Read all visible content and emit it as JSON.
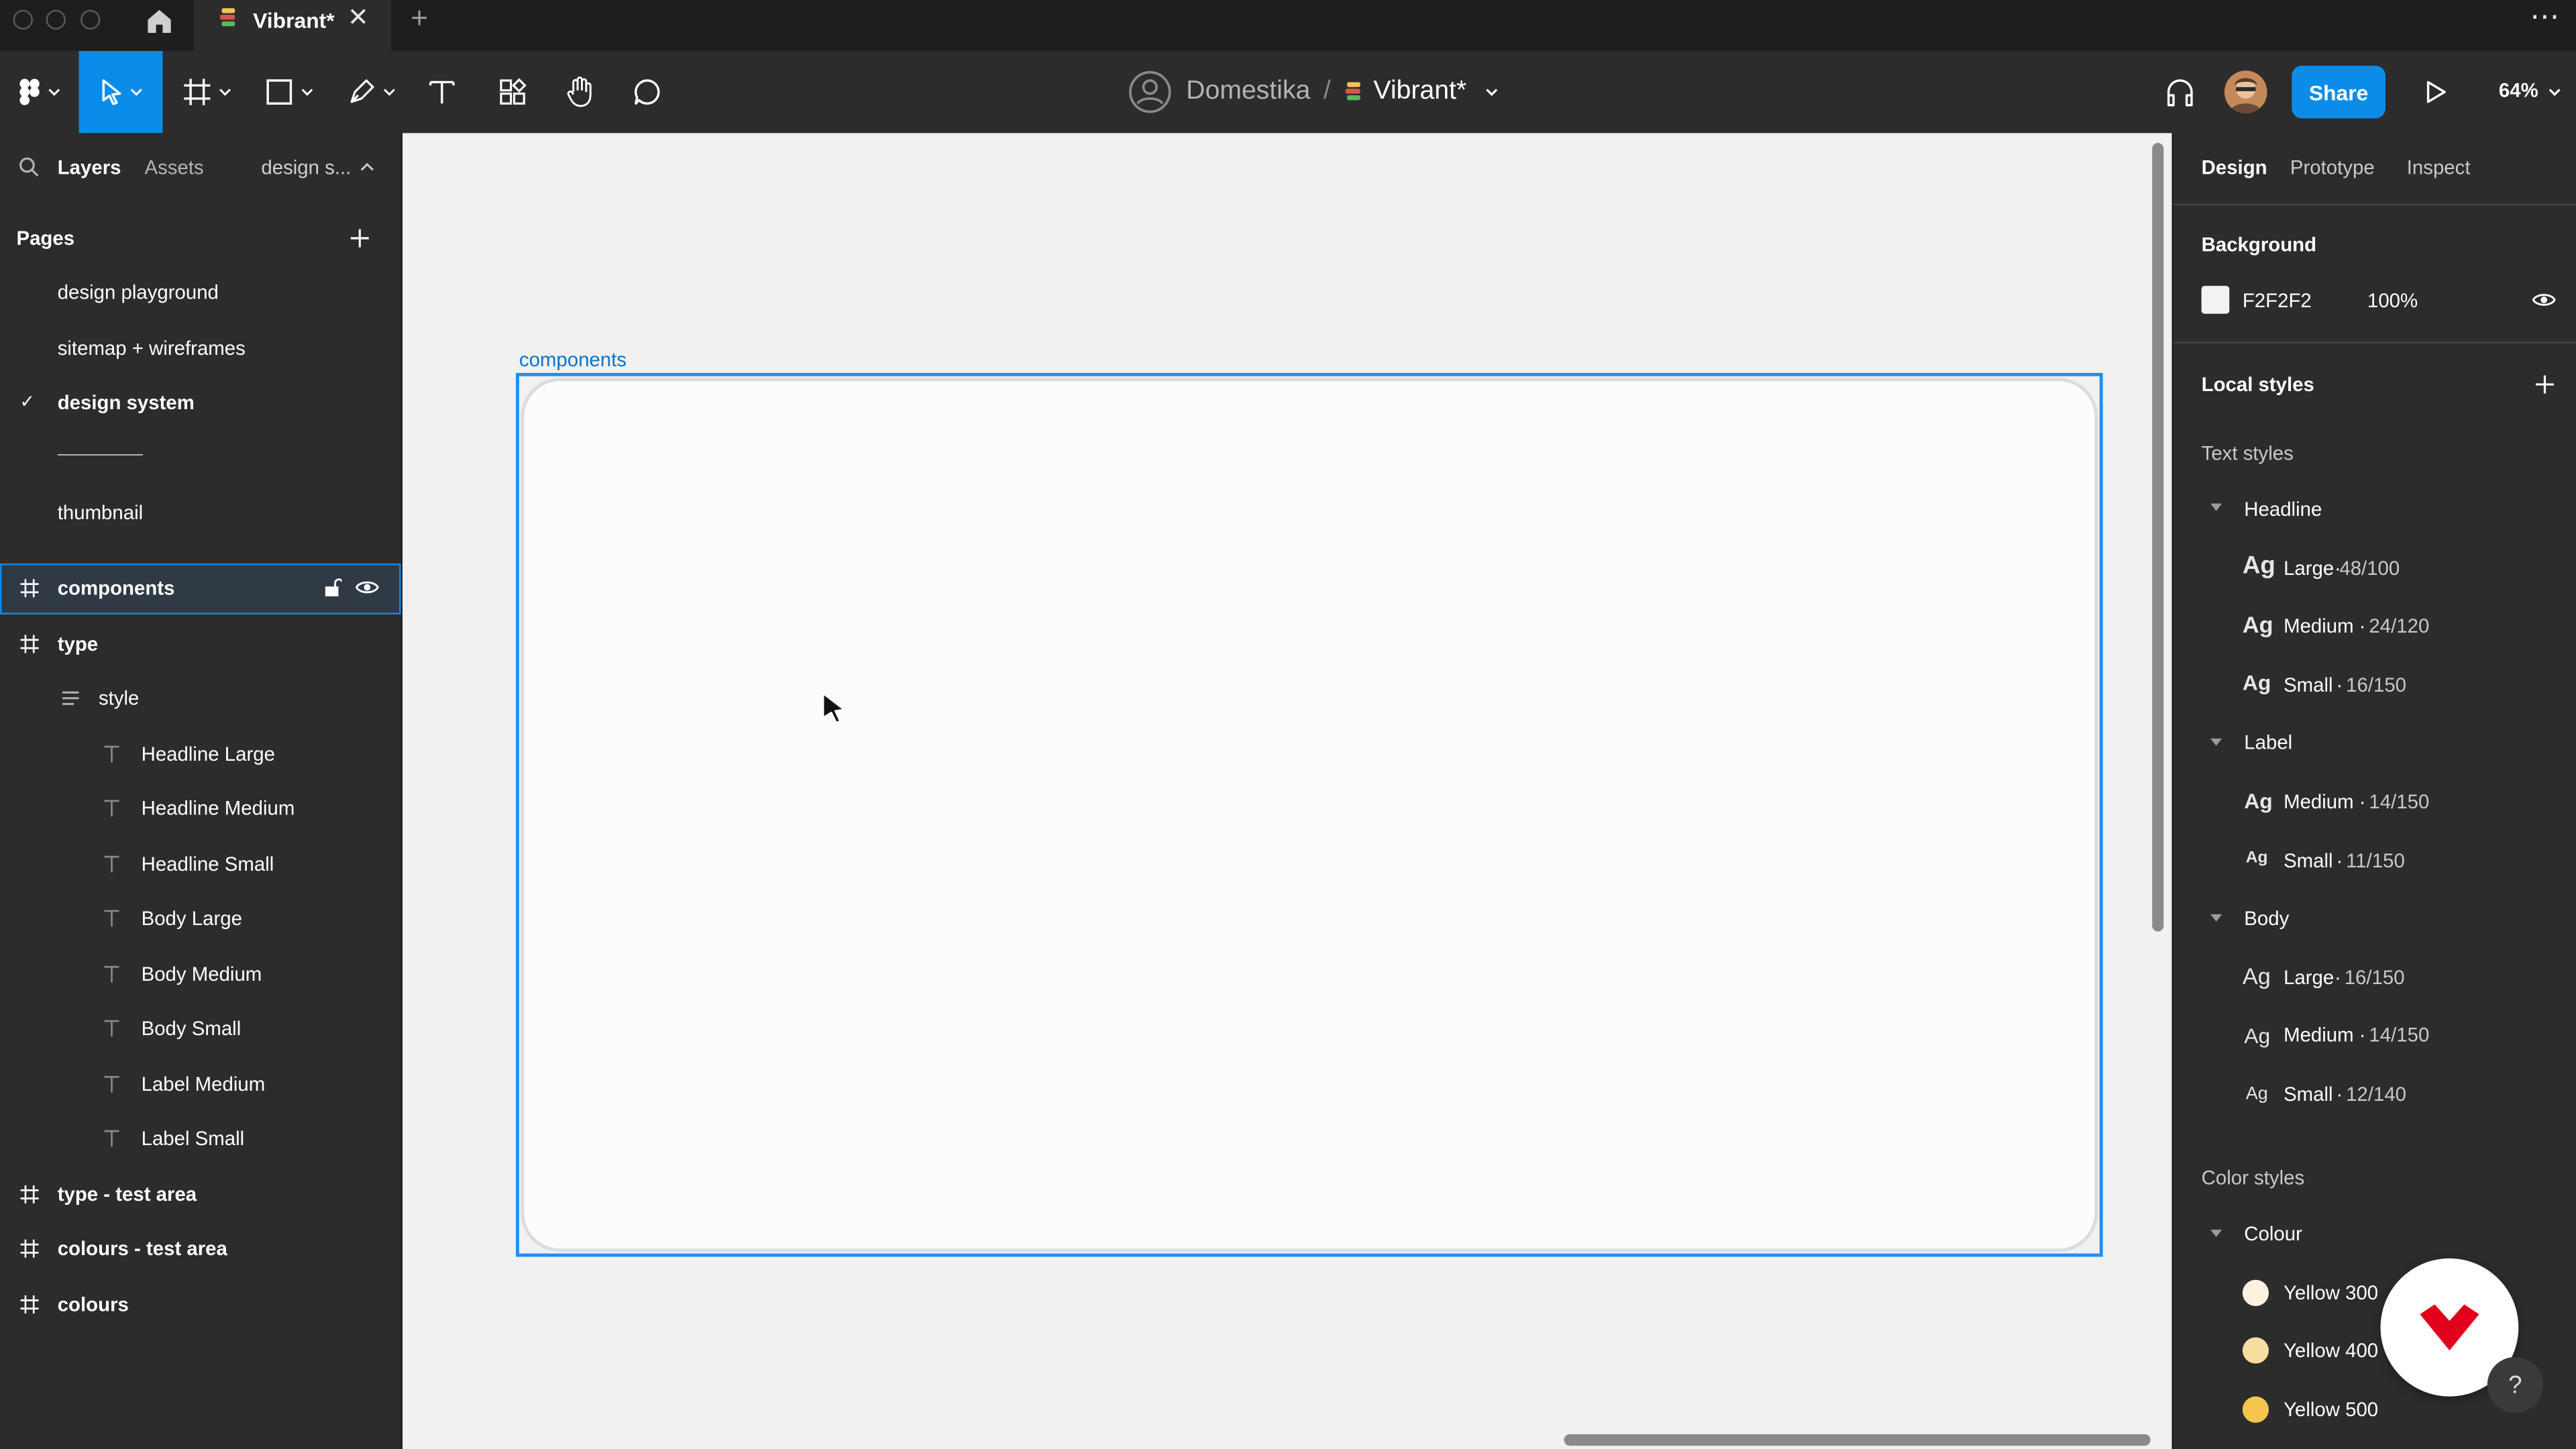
{
  "window": {
    "tab_title": "Vibrant*",
    "new_tab": "+",
    "more": "⋯"
  },
  "toolbar": {
    "team": "Domestika",
    "separator": "/",
    "file_name": "Vibrant*",
    "share_label": "Share",
    "zoom": "64%"
  },
  "left_panel": {
    "tabs": [
      "Layers",
      "Assets"
    ],
    "page_selector": "design s...",
    "pages_title": "Pages",
    "pages": [
      {
        "label": "design playground",
        "selected": false
      },
      {
        "label": "sitemap + wireframes",
        "selected": false
      },
      {
        "label": "design system",
        "selected": true
      },
      {
        "label": "—————",
        "selected": false
      },
      {
        "label": "thumbnail",
        "selected": false
      }
    ],
    "check_mark": "✓",
    "layers": [
      {
        "label": "components",
        "type": "frame",
        "selected": true
      },
      {
        "label": "type",
        "type": "frame"
      },
      {
        "label": "style",
        "type": "group"
      },
      {
        "label": "Headline Large",
        "type": "text"
      },
      {
        "label": "Headline Medium",
        "type": "text"
      },
      {
        "label": "Headline Small",
        "type": "text"
      },
      {
        "label": "Body Large",
        "type": "text"
      },
      {
        "label": "Body Medium",
        "type": "text"
      },
      {
        "label": "Body Small",
        "type": "text"
      },
      {
        "label": "Label Medium",
        "type": "text"
      },
      {
        "label": "Label Small",
        "type": "text"
      },
      {
        "label": "type - test area",
        "type": "frame"
      },
      {
        "label": "colours - test area",
        "type": "frame"
      },
      {
        "label": "colours",
        "type": "frame"
      }
    ]
  },
  "canvas": {
    "frame_label": "components",
    "background": "#F1F1F1"
  },
  "right_panel": {
    "tabs": [
      "Design",
      "Prototype",
      "Inspect"
    ],
    "background_title": "Background",
    "background_hex": "F2F2F2",
    "background_opacity": "100%",
    "local_styles_title": "Local styles",
    "text_styles_title": "Text styles",
    "text_style_groups": [
      {
        "name": "Headline",
        "styles": [
          {
            "ag": "Ag",
            "name": "Large",
            "spec": "48/100"
          },
          {
            "ag": "Ag",
            "name": "Medium",
            "spec": "24/120"
          },
          {
            "ag": "Ag",
            "name": "Small",
            "spec": "16/150"
          }
        ]
      },
      {
        "name": "Label",
        "styles": [
          {
            "ag": "Ag",
            "name": "Medium",
            "spec": "14/150"
          },
          {
            "ag": "Ag",
            "name": "Small",
            "spec": "11/150"
          }
        ]
      },
      {
        "name": "Body",
        "styles": [
          {
            "ag": "Ag",
            "name": "Large",
            "spec": "16/150"
          },
          {
            "ag": "Ag",
            "name": "Medium",
            "spec": "14/150"
          },
          {
            "ag": "Ag",
            "name": "Small",
            "spec": "12/140"
          }
        ]
      }
    ],
    "color_styles_title": "Color styles",
    "color_group": "Colour",
    "colors": [
      {
        "name": "Yellow 300",
        "hex": "#FBF3DF"
      },
      {
        "name": "Yellow 400",
        "hex": "#F8DDA0"
      },
      {
        "name": "Yellow 500",
        "hex": "#F5C550"
      }
    ],
    "help": "?"
  },
  "colors": {
    "accent": "#0C8CE9",
    "panel": "#2C2C2C",
    "titlebar": "#1E1E1E",
    "domestika_red": "#E0001B"
  }
}
